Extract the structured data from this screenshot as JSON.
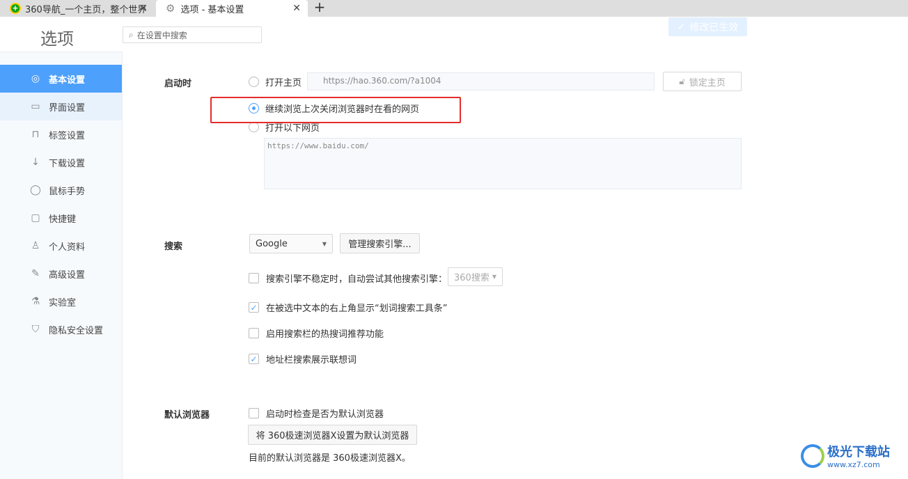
{
  "tabs": [
    {
      "label": "360导航_一个主页，整个世界",
      "icon": "360-logo-icon"
    },
    {
      "label": "选项 - 基本设置",
      "icon": "gear-icon"
    }
  ],
  "new_tab": "+",
  "close": "✕",
  "header": {
    "title": "选项",
    "search_placeholder": "在设置中搜索",
    "saved_label": "修改已生效"
  },
  "sidebar": {
    "items": [
      {
        "label": "基本设置",
        "icon": "settings-hex-icon",
        "glyph": "◎"
      },
      {
        "label": "界面设置",
        "icon": "window-icon",
        "glyph": "▭"
      },
      {
        "label": "标签设置",
        "icon": "tab-icon",
        "glyph": "⊓"
      },
      {
        "label": "下载设置",
        "icon": "download-icon",
        "glyph": "↓"
      },
      {
        "label": "鼠标手势",
        "icon": "mouse-icon",
        "glyph": "◯"
      },
      {
        "label": "快捷键",
        "icon": "shortcut-icon",
        "glyph": "▢"
      },
      {
        "label": "个人资料",
        "icon": "user-icon",
        "glyph": "♙"
      },
      {
        "label": "高级设置",
        "icon": "wrench-icon",
        "glyph": "✎"
      },
      {
        "label": "实验室",
        "icon": "flask-icon",
        "glyph": "⚗"
      },
      {
        "label": "隐私安全设置",
        "icon": "shield-icon",
        "glyph": "⛉"
      }
    ],
    "active": 0
  },
  "startup": {
    "label": "启动时",
    "options": [
      {
        "label": "打开主页",
        "selected": false
      },
      {
        "label": "继续浏览上次关闭浏览器时在看的网页",
        "selected": true
      },
      {
        "label": "打开以下网页",
        "selected": false
      }
    ],
    "homepage_url": "https://hao.360.com/?a1004",
    "lock_label": "锁定主页",
    "pages_text": "https://www.baidu.com/"
  },
  "search": {
    "label": "搜索",
    "engine": "Google",
    "manage_label": "管理搜索引擎...",
    "options": [
      {
        "label": "搜索引擎不稳定时，自动尝试其他搜索引擎：",
        "checked": false,
        "fallback": "360搜索"
      },
      {
        "label": "在被选中文本的右上角显示“划词搜索工具条”",
        "checked": true
      },
      {
        "label": "启用搜索栏的热搜词推荐功能",
        "checked": false
      },
      {
        "label": "地址栏搜索展示联想词",
        "checked": true
      }
    ]
  },
  "default_browser": {
    "label": "默认浏览器",
    "check_label": "启动时检查是否为默认浏览器",
    "checked": false,
    "set_button": "将 360极速浏览器X设置为默认浏览器",
    "status": "目前的默认浏览器是 360极速浏览器X。"
  },
  "watermark": {
    "name": "极光下载站",
    "url": "www.xz7.com"
  }
}
